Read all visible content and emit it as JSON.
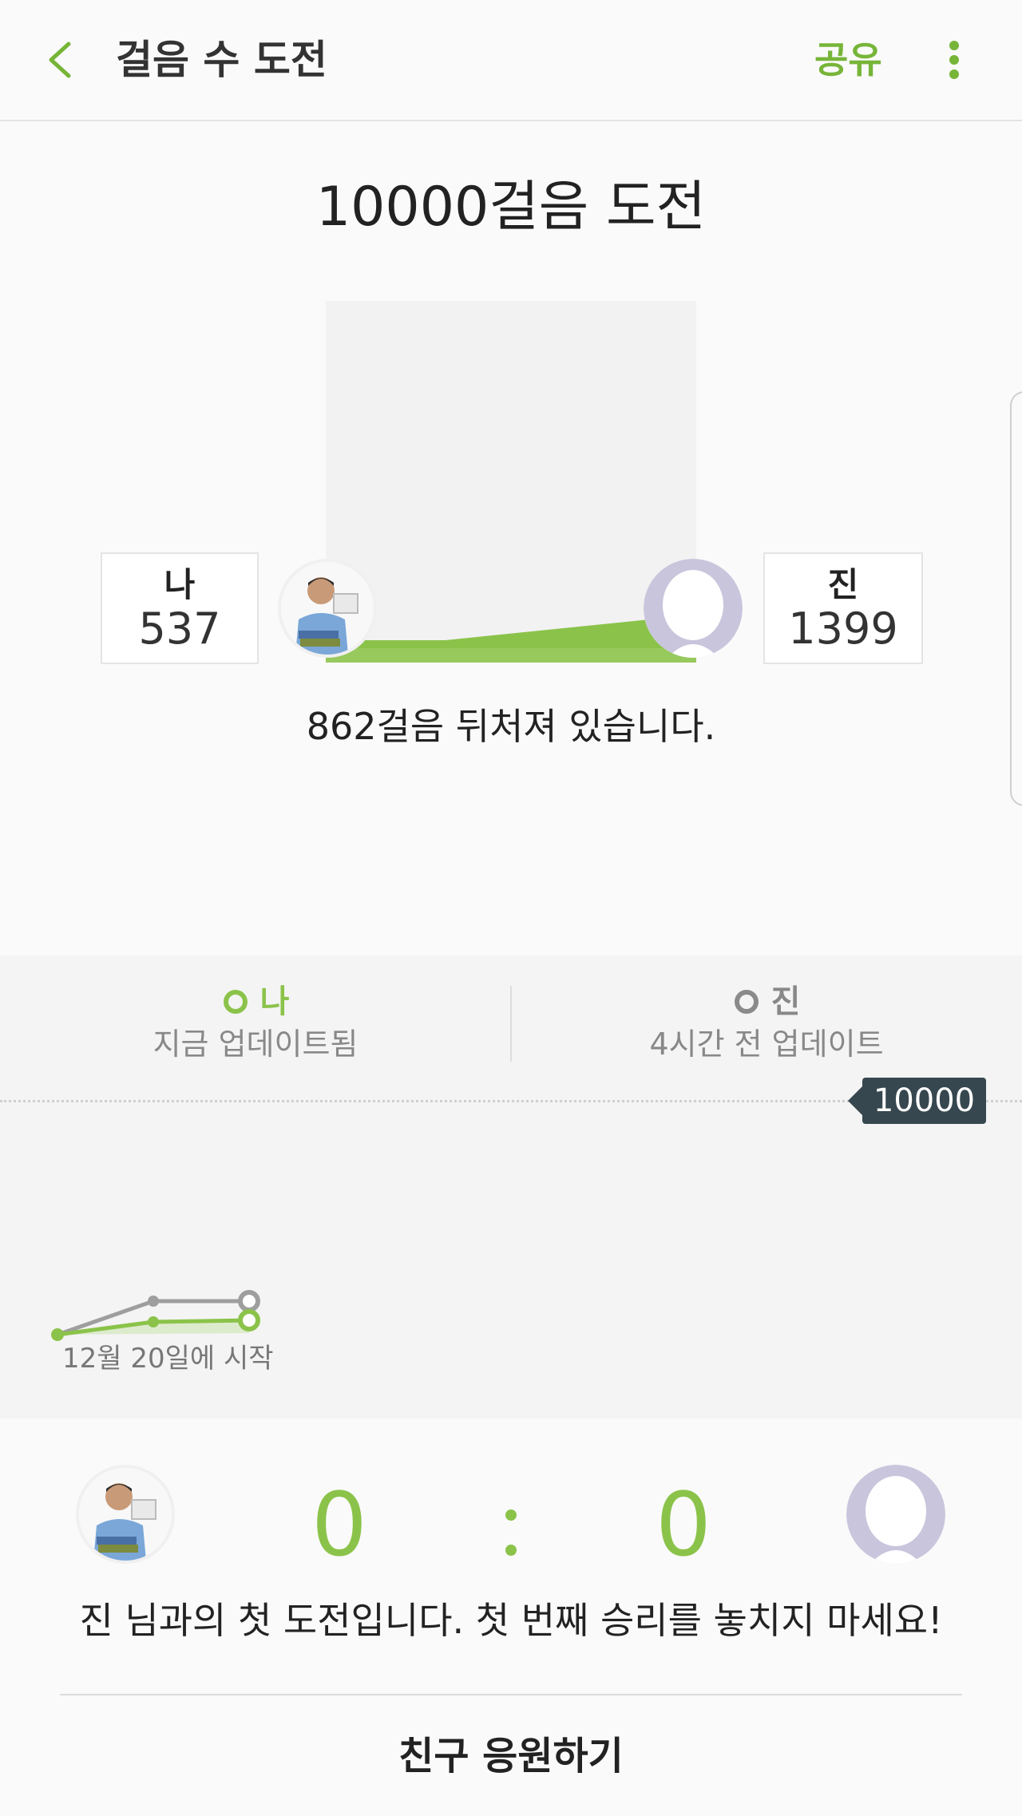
{
  "appbar": {
    "back_icon": "chevron-left-icon",
    "title": "걸음 수 도전",
    "share_label": "공유",
    "more_icon": "more-vertical-icon"
  },
  "challenge": {
    "title": "10000걸음 도전",
    "me": {
      "name": "나",
      "steps": "537",
      "avatar": "user-photo"
    },
    "friend": {
      "name": "진",
      "steps": "1399",
      "avatar": "default-avatar-icon"
    },
    "status": "862걸음 뒤처져 있습니다."
  },
  "graph": {
    "me_legend": "나",
    "me_updated": "지금 업데이트됨",
    "friend_legend": "진",
    "friend_updated": "4시간 전 업데이트",
    "goal": "10000",
    "start_label": "12월 20일에 시작",
    "colors": {
      "me": "#8bc34a",
      "friend": "#9e9e9e"
    }
  },
  "score": {
    "me": "0",
    "separator": ":",
    "friend": "0",
    "message": "진 님과의 첫 도전입니다. 첫 번째 승리를 놓치지 마세요!"
  },
  "cheer_button": "친구 응원하기",
  "accent_color": "#77b539"
}
